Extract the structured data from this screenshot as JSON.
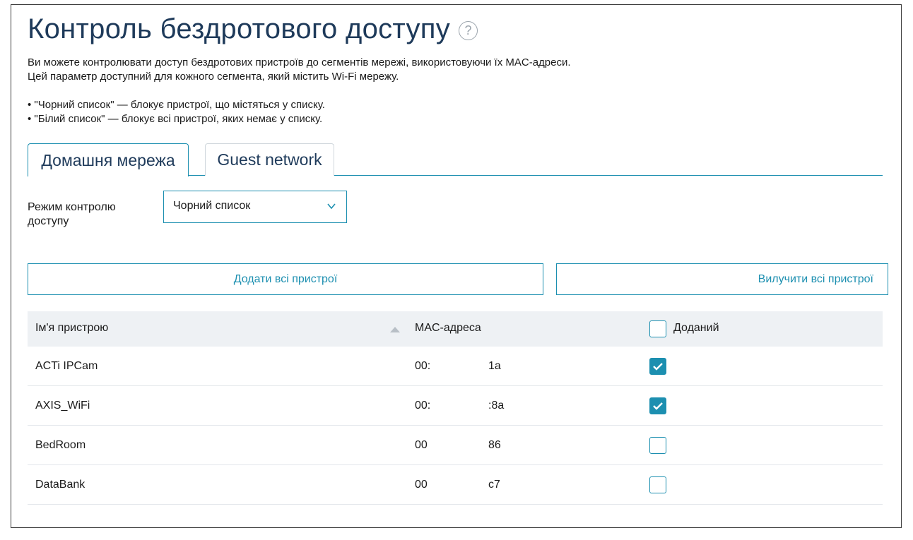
{
  "page": {
    "title": "Контроль бездротового доступу",
    "help_icon": "question-circle-icon",
    "description": {
      "line1": "Ви можете контролювати доступ бездротових пристроїв до сегментів мережі, використовуючи їх MAC-адреси.",
      "line2": "Цей параметр доступний для кожного сегмента, який містить Wi-Fi мережу.",
      "bullet1": "• \"Чорний список\" — блокує пристрої, що містяться у списку.",
      "bullet2": "• \"Білий список\" — блокує всі пристрої, яких немає у списку."
    }
  },
  "tabs": [
    {
      "label": "Домашня мережа",
      "active": true
    },
    {
      "label": "Guest network",
      "active": false
    }
  ],
  "mode": {
    "label": "Режим контролю доступу",
    "selected": "Чорний список",
    "icon": "chevron-down-icon"
  },
  "buttons": {
    "add_all": "Додати всі пристрої",
    "remove_all": "Вилучити всі пристрої"
  },
  "table": {
    "headers": {
      "name": "Ім'я пристрою",
      "mac": "MAC-адреса",
      "added": "Доданий"
    },
    "sort_icon": "sort-ascending-icon",
    "header_checkbox_checked": false,
    "rows": [
      {
        "name": "ACTi IPCam",
        "mac_start": "00:",
        "mac_end": "1a",
        "added": true
      },
      {
        "name": "AXIS_WiFi",
        "mac_start": "00:",
        "mac_end": ":8a",
        "added": true
      },
      {
        "name": "BedRoom",
        "mac_start": "00",
        "mac_end": "86",
        "added": false
      },
      {
        "name": "DataBank",
        "mac_start": "00",
        "mac_end": "c7",
        "added": false
      }
    ]
  },
  "colors": {
    "accent": "#1c8fb0",
    "title": "#1e3a5a",
    "header_bg": "#eef1f4"
  }
}
